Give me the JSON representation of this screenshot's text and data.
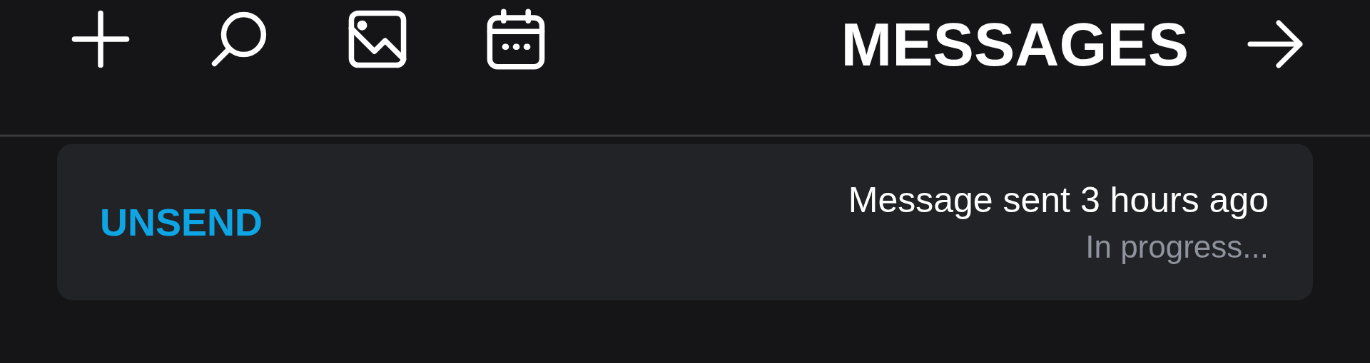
{
  "header": {
    "title": "MESSAGES"
  },
  "toolbar": [
    {
      "kind": "add"
    },
    {
      "kind": "search"
    },
    {
      "kind": "image"
    },
    {
      "kind": "calendar"
    }
  ],
  "message_card": {
    "status": "Message sent 3 hours ago",
    "detail": "In progress...",
    "action": "UNSEND"
  }
}
